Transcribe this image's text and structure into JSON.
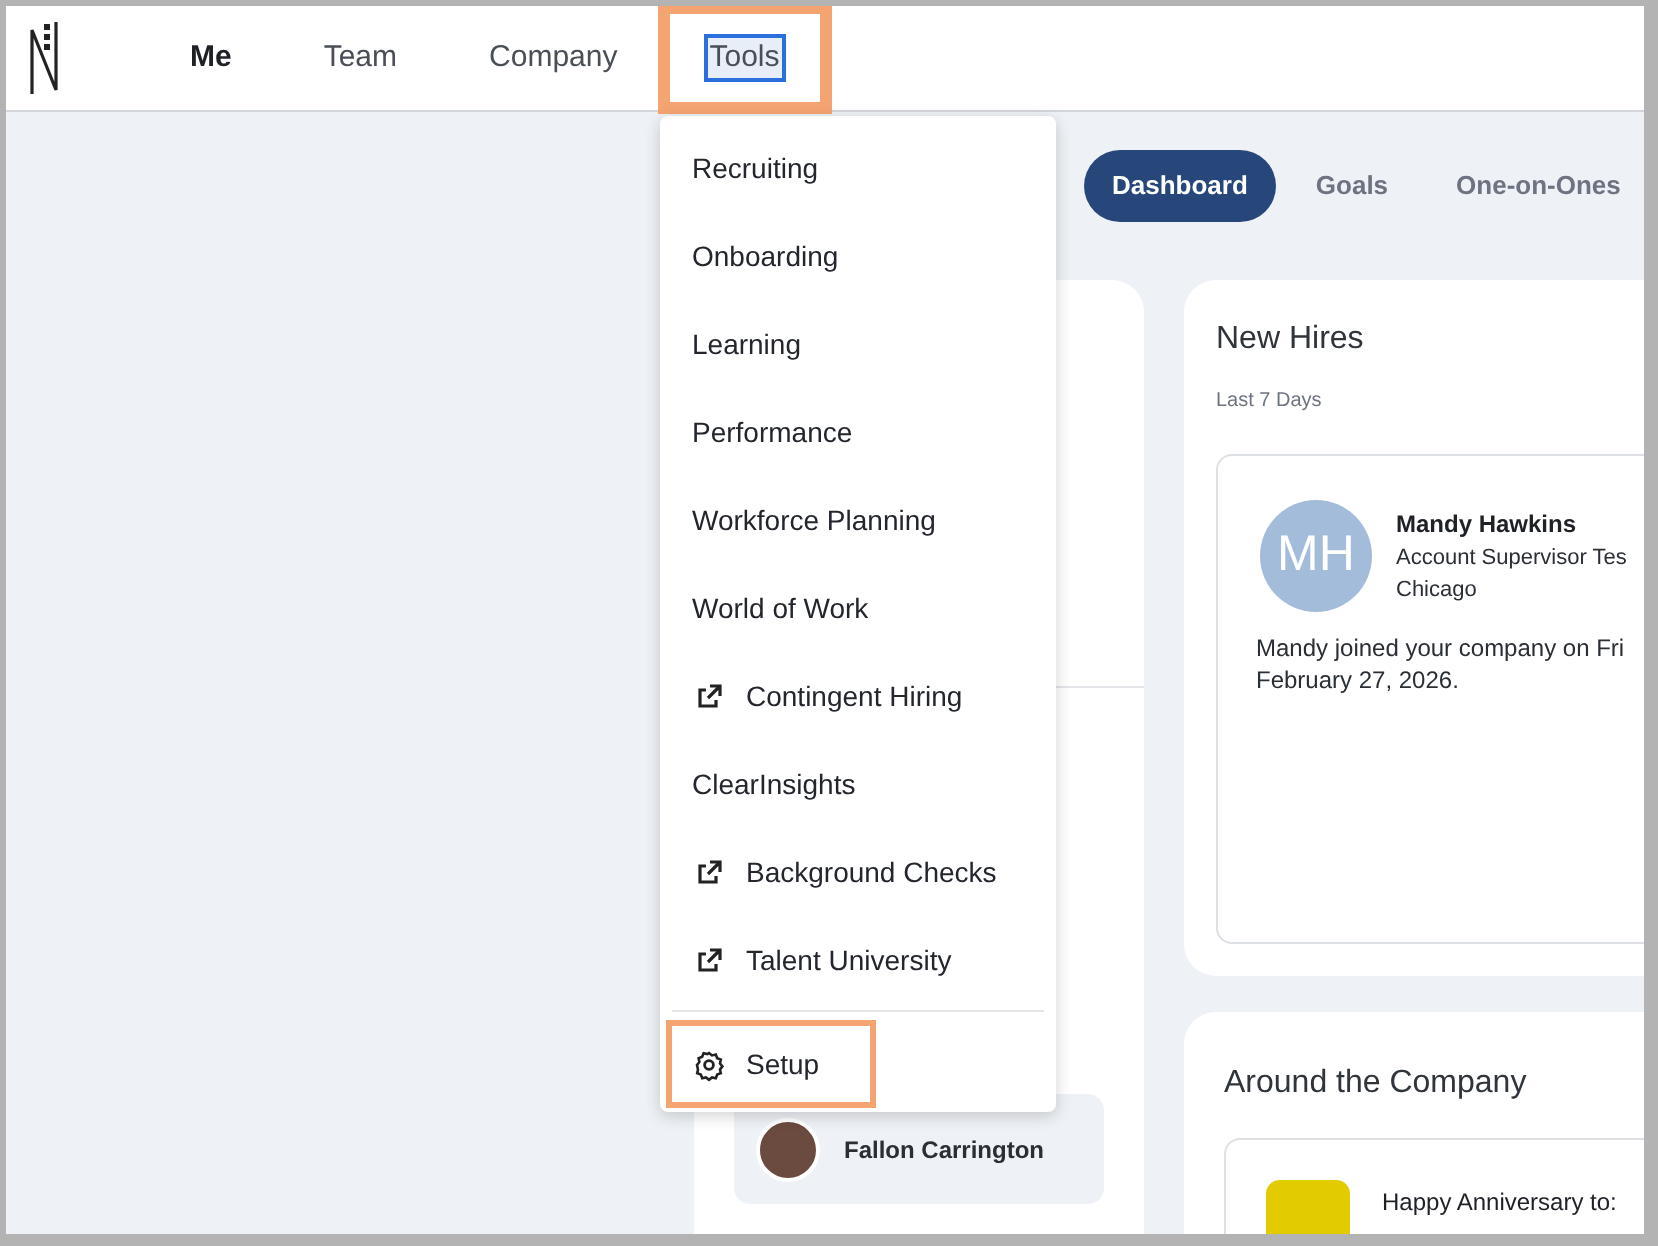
{
  "nav": {
    "items": [
      {
        "label": "Me",
        "selected": true,
        "highlighted": false,
        "focused": false
      },
      {
        "label": "Team",
        "selected": false,
        "highlighted": false,
        "focused": false
      },
      {
        "label": "Company",
        "selected": false,
        "highlighted": false,
        "focused": false
      },
      {
        "label": "Tools",
        "selected": false,
        "highlighted": true,
        "focused": true
      }
    ]
  },
  "tools_menu": {
    "items": [
      {
        "label": "Recruiting",
        "kind": "plain",
        "highlighted": false
      },
      {
        "label": "Onboarding",
        "kind": "plain",
        "highlighted": false
      },
      {
        "label": "Learning",
        "kind": "plain",
        "highlighted": false
      },
      {
        "label": "Performance",
        "kind": "plain",
        "highlighted": false
      },
      {
        "label": "Workforce Planning",
        "kind": "plain",
        "highlighted": false
      },
      {
        "label": "World of Work",
        "kind": "plain",
        "highlighted": false
      },
      {
        "label": "Contingent Hiring",
        "kind": "external",
        "highlighted": false
      },
      {
        "label": "ClearInsights",
        "kind": "plain",
        "highlighted": false
      },
      {
        "label": "Background Checks",
        "kind": "external",
        "highlighted": false
      },
      {
        "label": "Talent University",
        "kind": "external",
        "highlighted": false
      },
      {
        "label": "Setup",
        "kind": "settings",
        "highlighted": true
      }
    ]
  },
  "tabs": [
    {
      "label": "Dashboard",
      "selected": true
    },
    {
      "label": "Goals",
      "selected": false
    },
    {
      "label": "One-on-Ones",
      "selected": false
    }
  ],
  "left_card": {
    "person": {
      "name": "Fallon Carrington"
    }
  },
  "new_hires": {
    "title": "New Hires",
    "subtitle": "Last 7 Days",
    "hire": {
      "initials": "MH",
      "name": "Mandy Hawkins",
      "role": "Account Supervisor Tes",
      "location": "Chicago",
      "message": "Mandy joined your company on Fri",
      "date": "February 27, 2026."
    }
  },
  "around_company": {
    "title": "Around the Company",
    "entry": {
      "text": "Happy Anniversary to:"
    }
  }
}
